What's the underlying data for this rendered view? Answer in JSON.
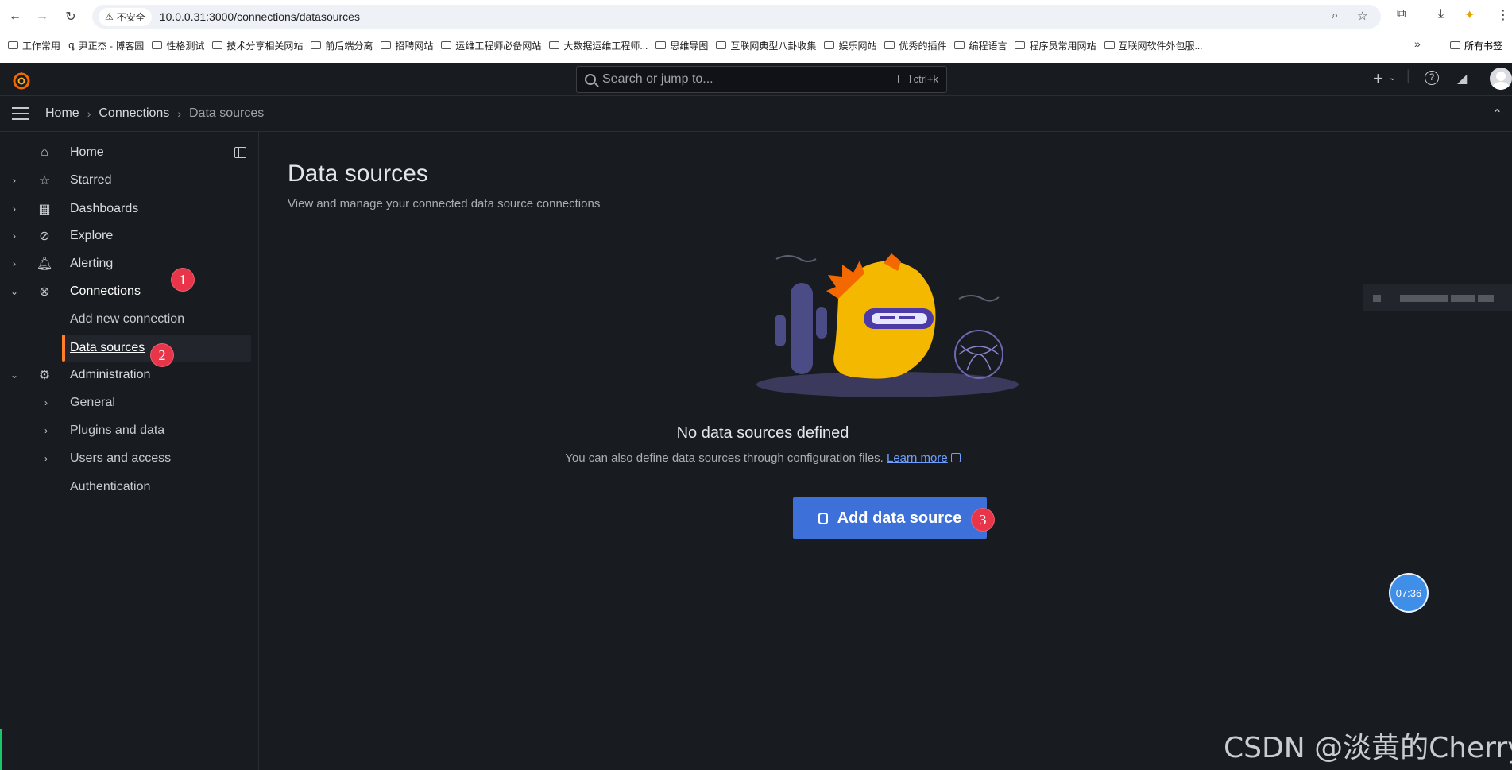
{
  "browser": {
    "security_label": "不安全",
    "url": "10.0.0.31:3000/connections/datasources",
    "bookmarks": [
      "工作常用",
      "尹正杰 - 博客园",
      "性格测试",
      "技术分享相关网站",
      "前后端分离",
      "招聘网站",
      "运维工程师必备网站",
      "大数据运维工程师...",
      "思维导图",
      "互联网典型八卦收集",
      "娱乐网站",
      "优秀的插件",
      "编程语言",
      "程序员常用网站",
      "互联网软件外包服..."
    ],
    "more_bookmarks": "»",
    "all_bookmarks": "所有书签"
  },
  "topbar": {
    "search_placeholder": "Search or jump to...",
    "shortcut": "ctrl+k",
    "plus": "+"
  },
  "breadcrumb": [
    "Home",
    "Connections",
    "Data sources"
  ],
  "sidebar": {
    "items": [
      {
        "label": "Home"
      },
      {
        "label": "Starred"
      },
      {
        "label": "Dashboards"
      },
      {
        "label": "Explore"
      },
      {
        "label": "Alerting"
      },
      {
        "label": "Connections"
      },
      {
        "label": "Add new connection"
      },
      {
        "label": "Data sources"
      },
      {
        "label": "Administration"
      },
      {
        "label": "General"
      },
      {
        "label": "Plugins and data"
      },
      {
        "label": "Users and access"
      },
      {
        "label": "Authentication"
      }
    ]
  },
  "main": {
    "title": "Data sources",
    "subtitle": "View and manage your connected data source connections",
    "empty_title": "No data sources defined",
    "empty_desc": "You can also define data sources through configuration files.",
    "learn_more": "Learn more",
    "add_button": "Add data source"
  },
  "annotations": {
    "one": "1",
    "two": "2",
    "three": "3"
  },
  "overlay": {
    "timer": "07:36",
    "watermark": "CSDN @淡黄的Cherry"
  },
  "colors": {
    "accent": "#3d71d9",
    "active_marker": "#ff7f2a",
    "badge": "#e8354a",
    "link": "#6e9fff"
  }
}
